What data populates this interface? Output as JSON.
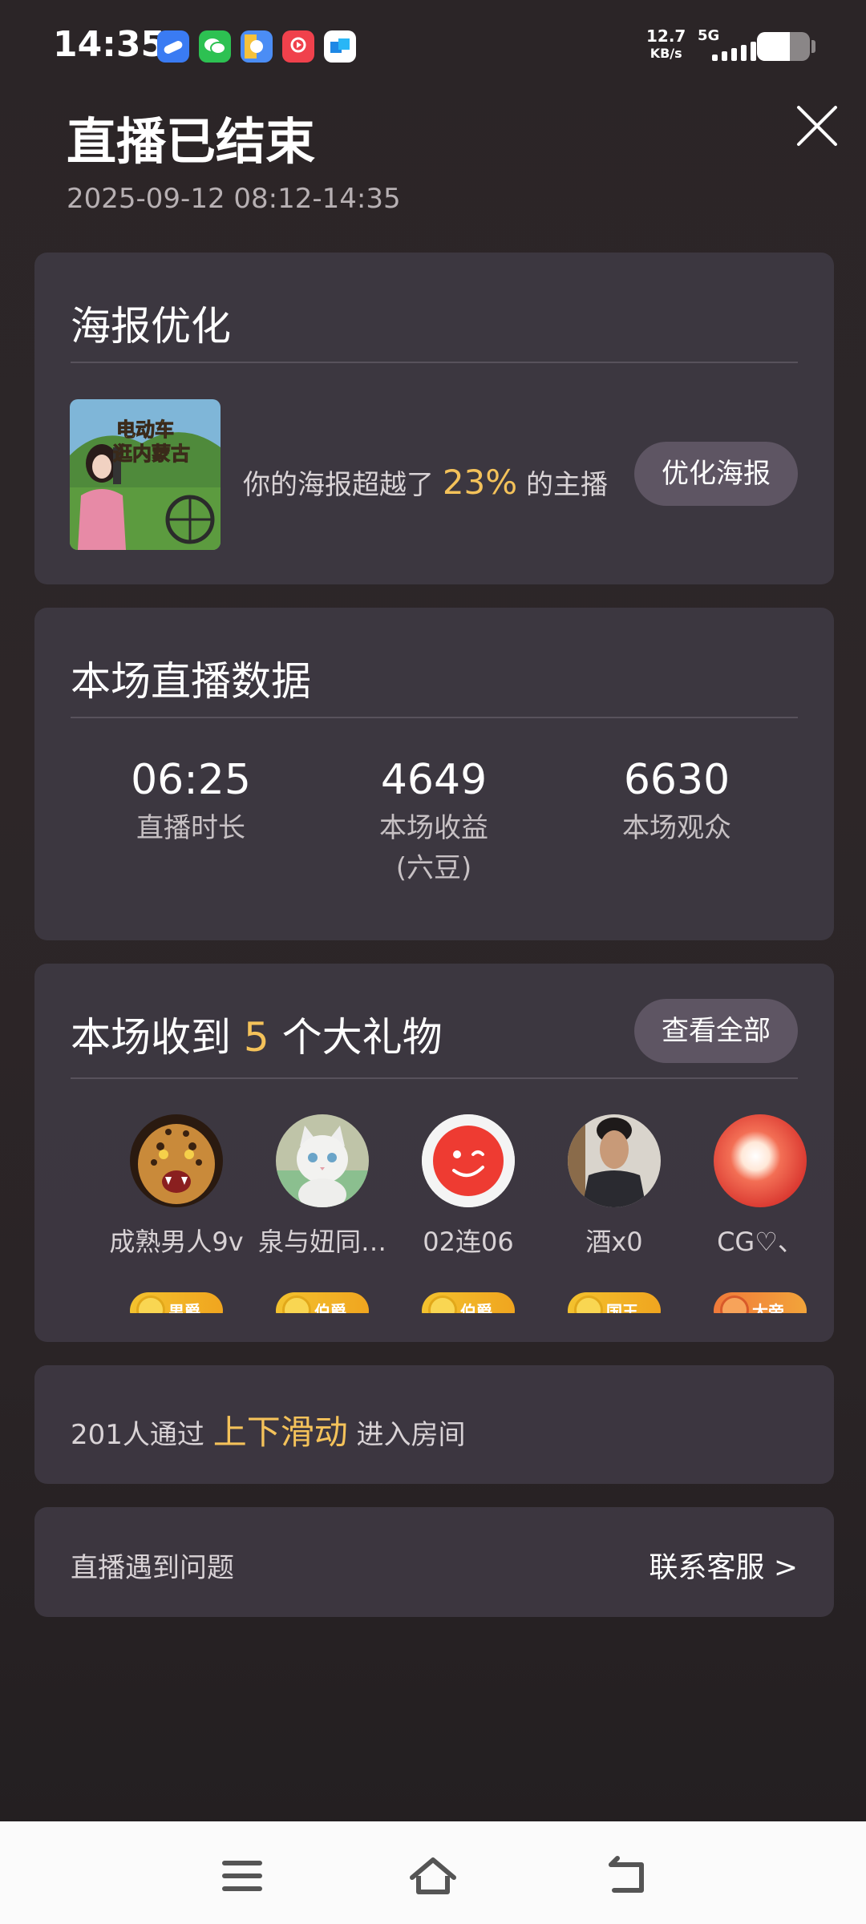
{
  "status_bar": {
    "time": "14:35",
    "net_speed_value": "12.7",
    "net_speed_unit": "KB/s",
    "network": "5G",
    "battery_level": 0.62,
    "app_icons": [
      "cloud-app-icon",
      "wechat-icon",
      "qq-browser-icon",
      "video-app-icon",
      "teams-app-icon"
    ]
  },
  "header": {
    "title": "直播已结束",
    "time_range": "2025-09-12 08:12-14:35"
  },
  "poster": {
    "title": "海报优化",
    "thumb_line1": "电动车",
    "thumb_line2": "逛内蒙古",
    "text_before": "你的海报超越了 ",
    "percent": "23%",
    "text_after": " 的主播",
    "button": "优化海报"
  },
  "stats": {
    "title": "本场直播数据",
    "items": [
      {
        "value": "06:25",
        "label": "直播时长",
        "label2": ""
      },
      {
        "value": "4649",
        "label": "本场收益",
        "label2": "(六豆)"
      },
      {
        "value": "6630",
        "label": "本场观众",
        "label2": ""
      }
    ]
  },
  "gifts": {
    "title_before": "本场收到 ",
    "count": "5",
    "title_after": " 个大礼物",
    "button": "查看全部",
    "gifters": [
      {
        "name": "成熟男人9v",
        "badge": "男爵"
      },
      {
        "name": "泉与妞同…",
        "badge": "伯爵"
      },
      {
        "name": "02连06",
        "badge": "伯爵"
      },
      {
        "name": "酒x0",
        "badge": "国王"
      },
      {
        "name": "CG♡、",
        "badge": "大帝"
      }
    ]
  },
  "slide": {
    "before": "201人通过 ",
    "highlight": "上下滑动",
    "after": " 进入房间"
  },
  "problem": {
    "label": "直播遇到问题",
    "link": "联系客服 >"
  },
  "colors": {
    "accent": "#f4c25a",
    "card_bg": "#3e3842",
    "pill_bg": "#5e5563"
  }
}
